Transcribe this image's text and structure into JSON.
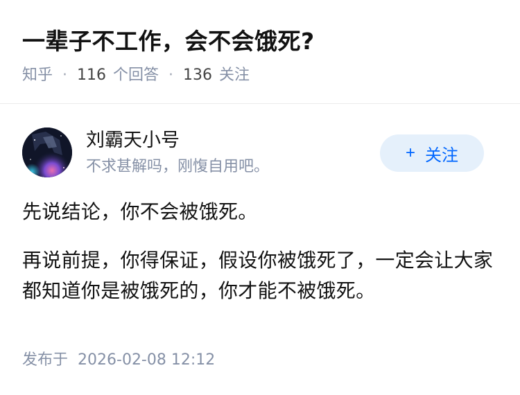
{
  "question": {
    "title": "一辈子不工作，会不会饿死?",
    "source": "知乎",
    "answer_count": "116",
    "answer_label": "个回答",
    "follower_count": "136",
    "follower_label": "关注",
    "separator": "·"
  },
  "author": {
    "name": "刘霸天小号",
    "bio": "不求甚解吗，刚愎自用吧。",
    "follow_button_plus": "+",
    "follow_button_label": "关注",
    "avatar": "avatar-image"
  },
  "answer": {
    "paragraphs": [
      "先说结论，你不会被饿死。",
      "再说前提，你得保证，假设你被饿死了，一定会让大家都知道你是被饿死的，你才能不被饿死。"
    ],
    "published_label": "发布于",
    "published_date": "2026-02-08 12:12"
  },
  "colors": {
    "accent": "#0066ff",
    "follow_bg": "#e5f0fb",
    "meta_gray": "#8590a6"
  }
}
